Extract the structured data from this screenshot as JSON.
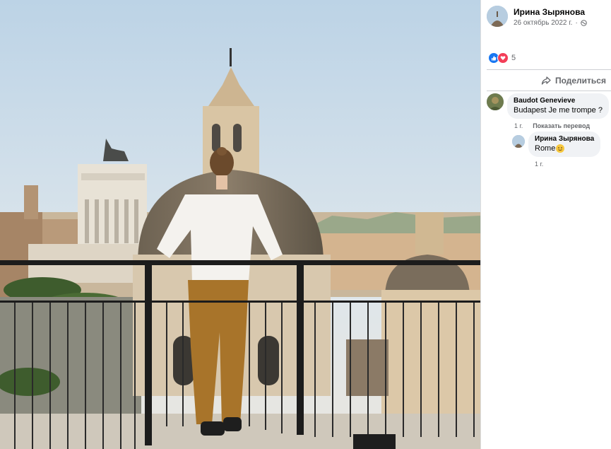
{
  "post": {
    "author": "Ирина Зырянова",
    "date": "26 октябрь 2022 г.",
    "privacy_icon": "globe-icon",
    "reaction_count": "5",
    "reaction_icons": [
      "like-icon",
      "love-icon"
    ],
    "share_label": "Поделиться"
  },
  "comments": [
    {
      "author": "Baudot Genevieve",
      "text": "Budapest Je me trompe ?",
      "age": "1 г.",
      "action": "Показать перевод"
    },
    {
      "author": "Ирина Зырянова",
      "text": "Rome",
      "emoji": "smiling-face-emoji",
      "age": "1 г."
    }
  ],
  "colors": {
    "link_blue": "#1877f2",
    "love_red": "#f33e58",
    "bubble_bg": "#f0f2f5",
    "secondary_text": "#65676b"
  }
}
